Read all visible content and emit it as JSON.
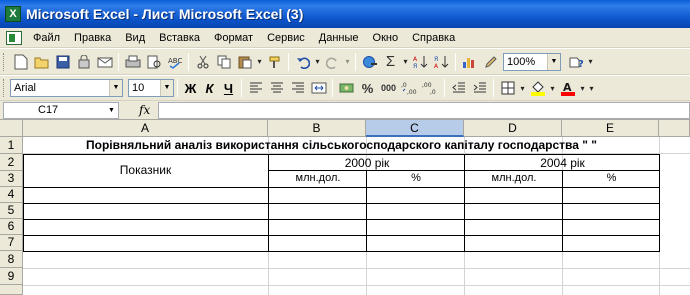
{
  "titlebar": {
    "app_icon_letter": "X",
    "title": "Microsoft Excel - Лист Microsoft Excel (3)"
  },
  "menu": [
    {
      "label": "Файл"
    },
    {
      "label": "Правка"
    },
    {
      "label": "Вид"
    },
    {
      "label": "Вставка"
    },
    {
      "label": "Формат"
    },
    {
      "label": "Сервис"
    },
    {
      "label": "Данные"
    },
    {
      "label": "Окно"
    },
    {
      "label": "Справка"
    }
  ],
  "toolbar1": {
    "zoom": "100%",
    "sum_symbol": "Σ",
    "help_symbol": "?"
  },
  "toolbar2": {
    "font_name": "Arial",
    "font_size": "10",
    "bold": "Ж",
    "italic": "К",
    "underline": "Ч",
    "percent": "%",
    "thousands": "000",
    "fill_color": "#ffff00",
    "font_color": "#ff0000"
  },
  "formula_bar": {
    "name_box": "C17",
    "fx_label": "fx",
    "formula": ""
  },
  "grid": {
    "columns": [
      "A",
      "B",
      "C",
      "D",
      "E"
    ],
    "selected_column": "C",
    "rows": [
      "1",
      "2",
      "3",
      "4",
      "5",
      "6",
      "7",
      "8",
      "9"
    ],
    "cells": {
      "title": "Порівняльний аналіз використання сільськогосподарского капіталу господарства \" \"",
      "indicator": "Показник",
      "year_2000": "2000 рік",
      "year_2004": "2004 рік",
      "unit_mln_1": "млн.дол.",
      "unit_pct_1": "%",
      "unit_mln_2": "млн.дол.",
      "unit_pct_2": "%"
    }
  }
}
